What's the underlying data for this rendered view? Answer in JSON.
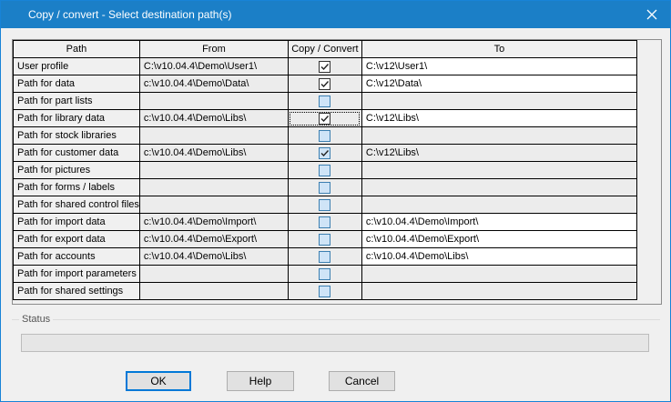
{
  "window": {
    "title": "Copy / convert - Select destination path(s)"
  },
  "table": {
    "headers": [
      "Path",
      "From",
      "Copy / Convert",
      "To"
    ],
    "rows": [
      {
        "path": "User profile",
        "from": "C:\\v10.04.4\\Demo\\User1\\",
        "copy": true,
        "to": "C:\\v12\\User1\\"
      },
      {
        "path": "Path for data",
        "from": "c:\\v10.04.4\\Demo\\Data\\",
        "copy": true,
        "to": "C:\\v12\\Data\\"
      },
      {
        "path": "Path for part lists",
        "from": "",
        "copy": false,
        "to": ""
      },
      {
        "path": "Path for library data",
        "from": "c:\\v10.04.4\\Demo\\Libs\\",
        "copy": true,
        "to": "C:\\v12\\Libs\\"
      },
      {
        "path": "Path for stock libraries",
        "from": "",
        "copy": false,
        "to": ""
      },
      {
        "path": "Path for customer data",
        "from": "c:\\v10.04.4\\Demo\\Libs\\",
        "copy": true,
        "to": "C:\\v12\\Libs\\"
      },
      {
        "path": "Path for pictures",
        "from": "",
        "copy": false,
        "to": ""
      },
      {
        "path": "Path for forms / labels",
        "from": "",
        "copy": false,
        "to": ""
      },
      {
        "path": "Path for shared control files",
        "from": "",
        "copy": false,
        "to": ""
      },
      {
        "path": "Path for import data",
        "from": "c:\\v10.04.4\\Demo\\Import\\",
        "copy": false,
        "to": "c:\\v10.04.4\\Demo\\Import\\"
      },
      {
        "path": "Path for export data",
        "from": "c:\\v10.04.4\\Demo\\Export\\",
        "copy": false,
        "to": "c:\\v10.04.4\\Demo\\Export\\"
      },
      {
        "path": "Path for accounts",
        "from": "c:\\v10.04.4\\Demo\\Libs\\",
        "copy": false,
        "to": "c:\\v10.04.4\\Demo\\Libs\\"
      },
      {
        "path": "Path for import parameters",
        "from": "",
        "copy": false,
        "to": ""
      },
      {
        "path": "Path for shared settings",
        "from": "",
        "copy": false,
        "to": ""
      }
    ]
  },
  "status": {
    "label": "Status",
    "progress": 0
  },
  "buttons": {
    "ok": "OK",
    "help": "Help",
    "cancel": "Cancel"
  },
  "colors": {
    "titlebar": "#1b7fc7",
    "default_button_border": "#0078d7",
    "checkbox_empty": "#cfe4f7"
  }
}
